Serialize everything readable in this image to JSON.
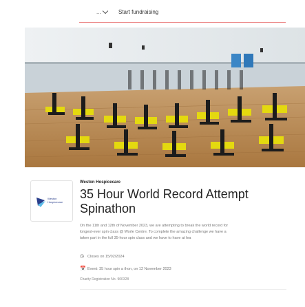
{
  "nav": {
    "dropdown_label": "...",
    "fundraise_link": "Start fundraising"
  },
  "charity": {
    "name": "Weston Hospicecare",
    "logo_text_line1": "Weston",
    "logo_text_line2": "Hospicecare",
    "logo_color": "#2a3f8c"
  },
  "page": {
    "title_line1": "35 Hour World Record Attempt",
    "title_line2": "Spinathon",
    "description_line1": "On the 11th and 12th of November 2023, we are attempting to break the world record for",
    "description_line2": "longest-ever spin class @ Worle Centre. To complete the amazing challenge we have a",
    "description_line3": "taken part in the full 35-hour spin class and we have to have at lea",
    "closes": "Closes on 15/02/2024",
    "event": "Event: 35 hour spin a thon, on 12 November 2023",
    "registration": "Charity Registration No. 900328"
  },
  "icons": {
    "closes": "timer-icon",
    "event": "calendar-icon"
  },
  "colors": {
    "accent": "#d33333"
  }
}
